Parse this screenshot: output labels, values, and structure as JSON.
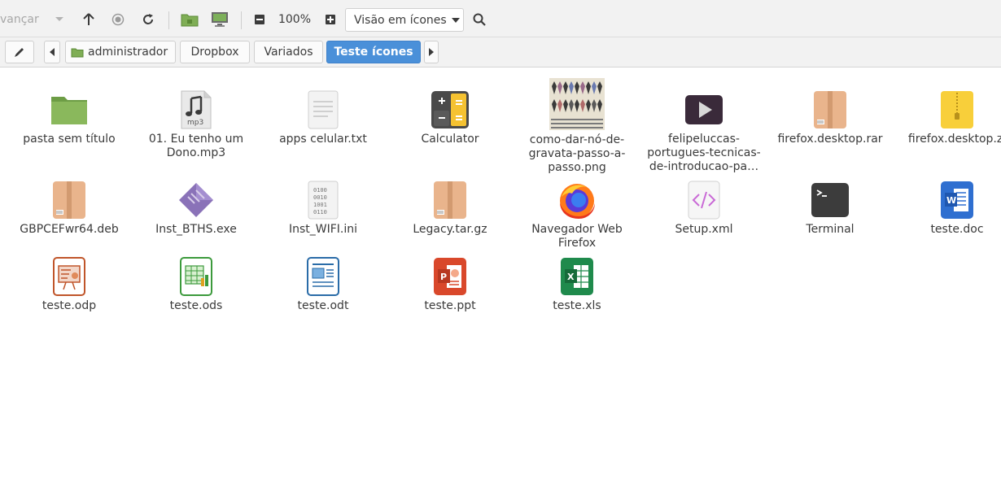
{
  "toolbar": {
    "forward_label": "vançar",
    "zoom_level": "100%",
    "view_mode": "Visão em ícones"
  },
  "pathbar": {
    "crumbs": [
      "administrador",
      "Dropbox",
      "Variados",
      "Teste ícones"
    ]
  },
  "files": [
    {
      "name": "pasta sem título",
      "icon": "folder-icon"
    },
    {
      "name": "01. Eu tenho um Dono.mp3",
      "icon": "audio-file-icon"
    },
    {
      "name": "apps celular.txt",
      "icon": "text-file-icon"
    },
    {
      "name": "Calculator",
      "icon": "calculator-icon"
    },
    {
      "name": "como-dar-nó-de-gravata-passo-a-passo.png",
      "icon": "image-thumbnail-icon"
    },
    {
      "name": "felipeluccas-portugues-tecnicas-de-introducao-pa…",
      "icon": "video-file-icon"
    },
    {
      "name": "firefox.desktop.rar",
      "icon": "archive-icon"
    },
    {
      "name": "firefox.desktop.zi",
      "icon": "zip-archive-icon"
    },
    {
      "name": "GBPCEFwr64.deb",
      "icon": "deb-package-icon"
    },
    {
      "name": "Inst_BTHS.exe",
      "icon": "executable-icon"
    },
    {
      "name": "Inst_WIFI.ini",
      "icon": "binary-file-icon"
    },
    {
      "name": "Legacy.tar.gz",
      "icon": "tar-archive-icon"
    },
    {
      "name": "Navegador Web Firefox",
      "icon": "firefox-icon"
    },
    {
      "name": "Setup.xml",
      "icon": "xml-file-icon"
    },
    {
      "name": "Terminal",
      "icon": "terminal-icon"
    },
    {
      "name": "teste.doc",
      "icon": "word-document-icon"
    },
    {
      "name": "teste.odp",
      "icon": "presentation-icon"
    },
    {
      "name": "teste.ods",
      "icon": "spreadsheet-icon"
    },
    {
      "name": "teste.odt",
      "icon": "text-document-icon"
    },
    {
      "name": "teste.ppt",
      "icon": "powerpoint-icon"
    },
    {
      "name": "teste.xls",
      "icon": "excel-icon"
    }
  ]
}
